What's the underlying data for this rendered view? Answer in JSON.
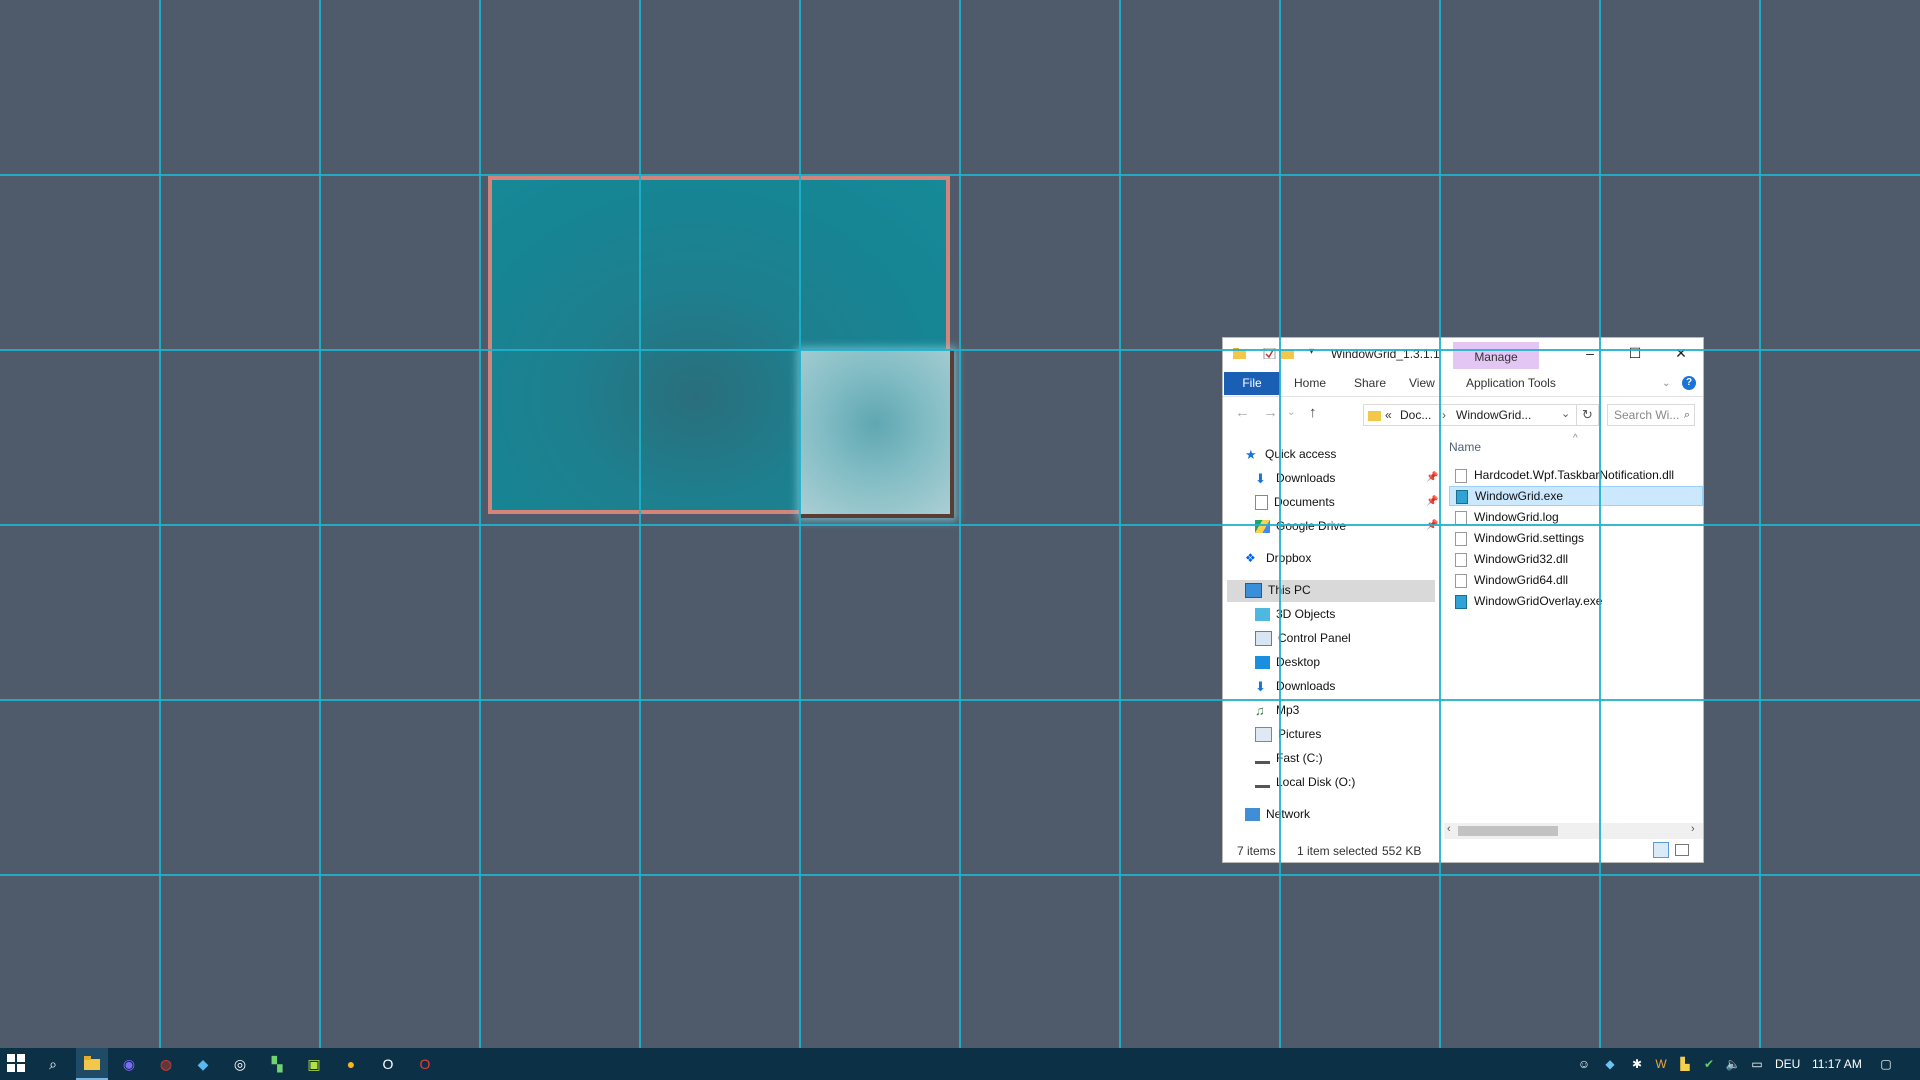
{
  "explorer": {
    "title": "WindowGrid_1.3.1.1",
    "manage_tab": "Manage",
    "app_tools": "Application Tools",
    "tabs": [
      "File",
      "Home",
      "Share",
      "View"
    ],
    "address": {
      "prefix": "«",
      "crumb1": "Doc...",
      "sep": "›",
      "crumb2": "WindowGrid..."
    },
    "search_placeholder": "Search Wi...",
    "column_name": "Name",
    "nav": [
      {
        "label": "Quick access",
        "icon": "star-icon"
      },
      {
        "label": "Downloads",
        "icon": "download-icon",
        "pinned": true
      },
      {
        "label": "Documents",
        "icon": "document-icon",
        "pinned": true
      },
      {
        "label": "Google Drive",
        "icon": "google-drive-icon",
        "pinned": true
      },
      {
        "label": "Dropbox",
        "icon": "dropbox-icon"
      },
      {
        "label": "This PC",
        "icon": "computer-icon"
      },
      {
        "label": "3D Objects",
        "icon": "cube-icon"
      },
      {
        "label": "Control Panel",
        "icon": "control-panel-icon"
      },
      {
        "label": "Desktop",
        "icon": "desktop-icon"
      },
      {
        "label": "Downloads",
        "icon": "download-icon"
      },
      {
        "label": "Mp3",
        "icon": "music-icon"
      },
      {
        "label": "Pictures",
        "icon": "pictures-icon"
      },
      {
        "label": "Fast (C:)",
        "icon": "drive-icon"
      },
      {
        "label": "Local Disk (O:)",
        "icon": "drive-icon"
      },
      {
        "label": "Network",
        "icon": "network-icon"
      }
    ],
    "files": [
      "Hardcodet.Wpf.TaskbarNotification.dll",
      "WindowGrid.exe",
      "WindowGrid.log",
      "WindowGrid.settings",
      "WindowGrid32.dll",
      "WindowGrid64.dll",
      "WindowGridOverlay.exe"
    ],
    "selected_file_index": 1,
    "status_items": "7 items",
    "status_selected": "1 item selected",
    "status_size": "552 KB"
  },
  "taskbar": {
    "language": "DEU",
    "time": "11:17 AM"
  },
  "colors": {
    "desktop": "#4f5b6b",
    "grid_line": "#1fb1cc",
    "selection_border": "#d5847a",
    "taskbar": "#0c3147"
  }
}
